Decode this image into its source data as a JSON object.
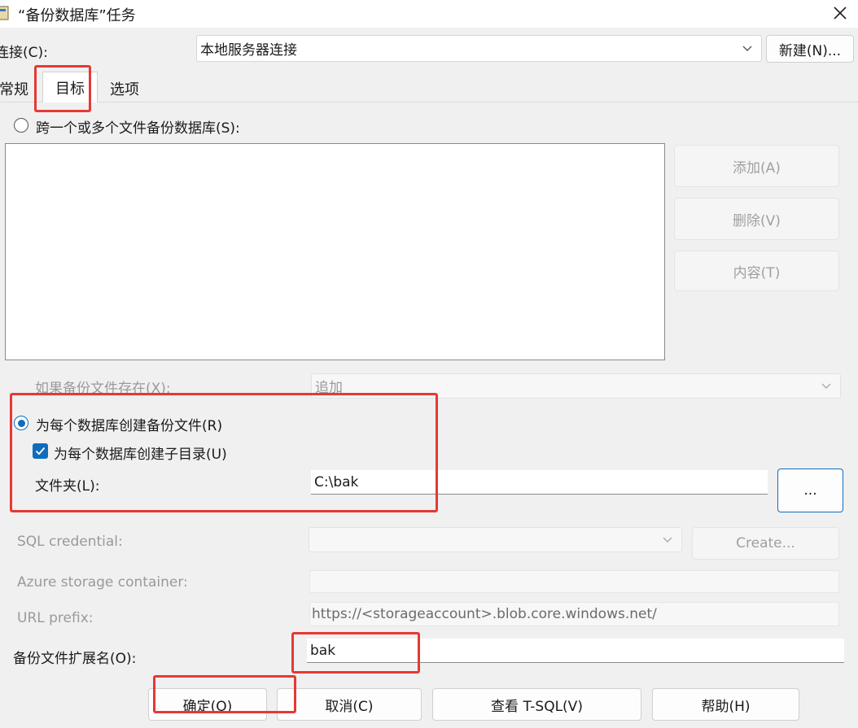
{
  "window": {
    "title": "“备份数据库”任务"
  },
  "connection": {
    "label": "连接(C):",
    "value": "本地服务器连接",
    "new_button": "新建(N)..."
  },
  "tabs": [
    {
      "label": "常规"
    },
    {
      "label": "目标"
    },
    {
      "label": "选项"
    }
  ],
  "target": {
    "span_files_label": "跨一个或多个文件备份数据库(S):",
    "add_button": "添加(A)",
    "remove_button": "删除(V)",
    "contents_button": "内容(T)",
    "if_exists_label": "如果备份文件存在(X):",
    "if_exists_value": "追加",
    "per_db_label": "为每个数据库创建备份文件(R)",
    "subdir_label": "为每个数据库创建子目录(U)",
    "folder_label": "文件夹(L):",
    "folder_value": "C:\\bak",
    "browse_button": "...",
    "sql_credential_label": "SQL credential:",
    "create_button": "Create...",
    "azure_container_label": "Azure storage container:",
    "url_prefix_label": "URL prefix:",
    "url_prefix_value": "https://<storageaccount>.blob.core.windows.net/",
    "extension_label": "备份文件扩展名(O):",
    "extension_value": "bak"
  },
  "footer": {
    "ok_button": "确定(O)",
    "cancel_button": "取消(C)",
    "view_tsql_button": "查看 T-SQL(V)",
    "help_button": "帮助(H)"
  },
  "colors": {
    "accent": "#0f6cbd",
    "highlight": "#e53935"
  }
}
